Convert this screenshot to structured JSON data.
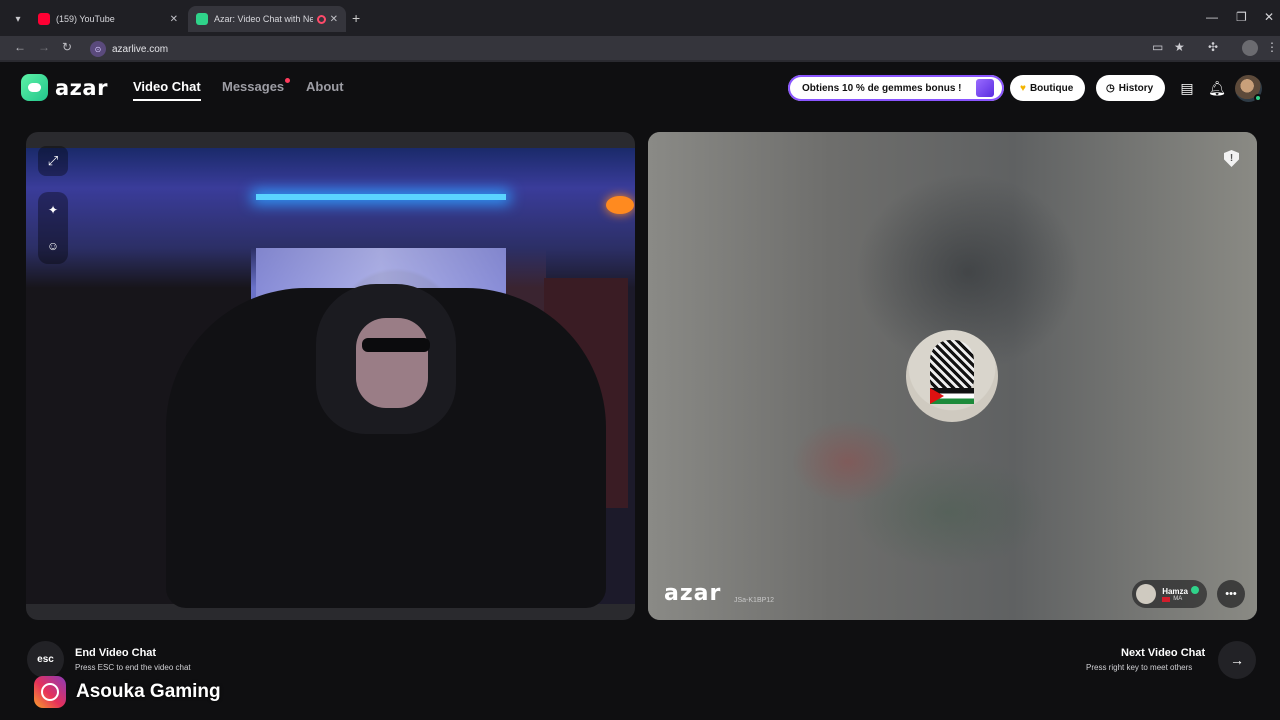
{
  "browser": {
    "tabs": [
      {
        "title": "(159) YouTube",
        "icon": "youtube-icon"
      },
      {
        "title": "Azar: Video Chat with New",
        "icon": "azar-icon"
      }
    ],
    "url": "azarlive.com"
  },
  "header": {
    "logo_text": "azar",
    "nav": [
      "Video Chat",
      "Messages",
      "About"
    ],
    "promo_label": "Obtiens 10 % de gemmes bonus !",
    "shop_label": "Boutique",
    "history_label": "History"
  },
  "partner": {
    "overlay_logo": "azar",
    "session_id": "JSa-K1BP12",
    "name": "Hamza",
    "country": "MA"
  },
  "footer": {
    "esc_key": "esc",
    "end_title": "End Video Chat",
    "end_sub": "Press ESC to end the video chat",
    "next_title": "Next Video Chat",
    "next_sub": "Press right key to meet others"
  },
  "watermark": {
    "text": "Asouka Gaming",
    "icon": "instagram-icon"
  },
  "colors": {
    "brand_green": "#2fd38a",
    "promo_border": "#8a55ff",
    "notification_dot": "#ff3b5c"
  }
}
